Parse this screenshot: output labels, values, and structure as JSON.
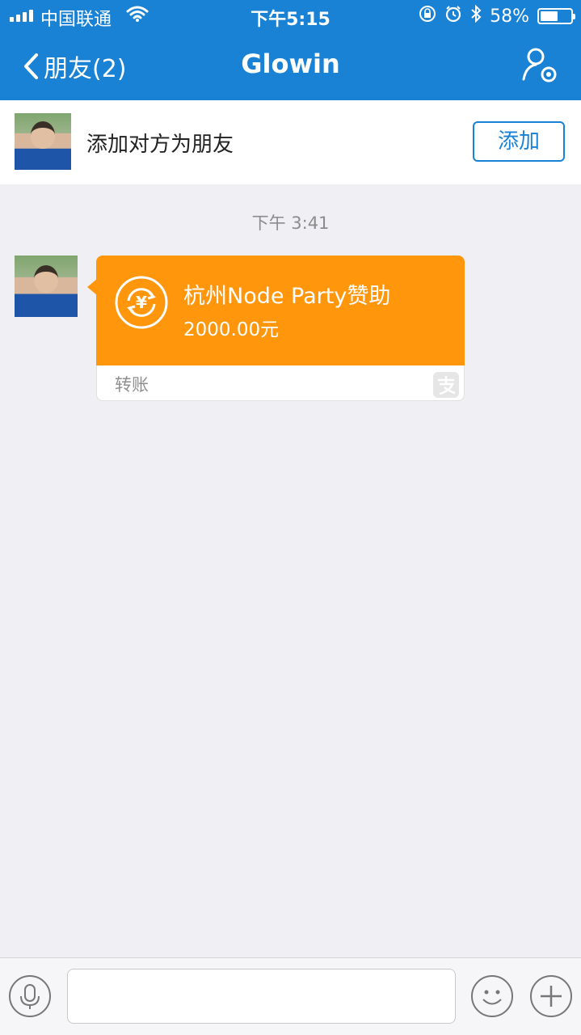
{
  "status_bar": {
    "carrier": "中国联通",
    "time": "下午5:15",
    "battery_percent": "58%",
    "battery_level": 0.58
  },
  "nav": {
    "back_label": "朋友(2)",
    "title": "Glowin"
  },
  "add_friend": {
    "text": "添加对方为朋友",
    "button_label": "添加"
  },
  "chat": {
    "timestamp": "下午 3:41",
    "transfer": {
      "title": "杭州Node Party赞助",
      "amount": "2000.00元",
      "label": "转账"
    }
  },
  "colors": {
    "header": "#1a82d4",
    "transfer_orange": "#ff960c",
    "background": "#efeff4"
  },
  "icons": [
    "signal-icon",
    "wifi-icon",
    "lock-rotation-icon",
    "alarm-icon",
    "bluetooth-icon",
    "battery-icon",
    "back-chevron-icon",
    "contact-settings-icon",
    "yuan-transfer-icon",
    "alipay-icon",
    "microphone-icon",
    "emoji-icon",
    "plus-icon"
  ]
}
